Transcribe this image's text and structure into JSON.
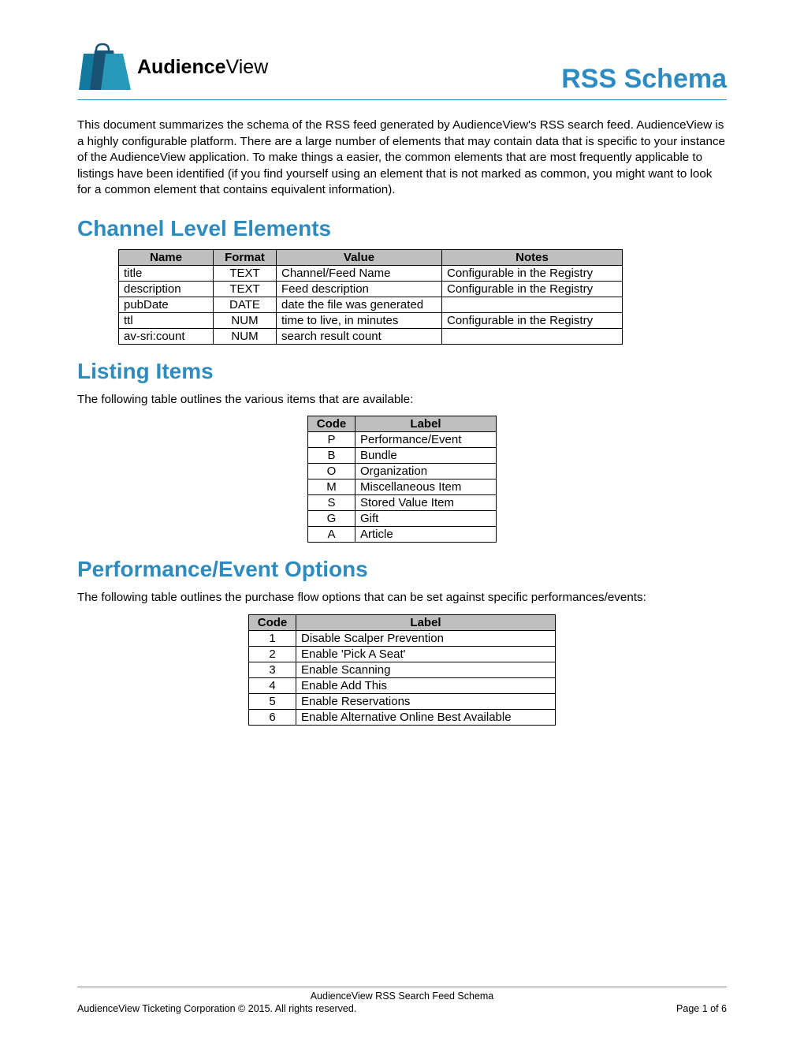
{
  "header": {
    "logo_bold": "Audience",
    "logo_light": "View",
    "doc_title": "RSS Schema"
  },
  "intro": "This document summarizes the schema of the RSS feed generated by AudienceView's RSS search feed. AudienceView is a highly configurable platform. There are a large number of elements that may contain data that is  specific to your instance of the AudienceView application. To make things a easier, the common elements that are most frequently applicable to listings have been identified (if you find yourself using an element that is not marked as common, you might want to look for a common element that contains equivalent information).",
  "sections": {
    "channel": {
      "title": "Channel Level Elements",
      "headers": [
        "Name",
        "Format",
        "Value",
        "Notes"
      ],
      "rows": [
        [
          "title",
          "TEXT",
          "Channel/Feed Name",
          "Configurable in the Registry"
        ],
        [
          "description",
          "TEXT",
          "Feed description",
          "Configurable in the Registry"
        ],
        [
          "pubDate",
          "DATE",
          "date the file was generated",
          ""
        ],
        [
          "ttl",
          "NUM",
          "time to live, in minutes",
          "Configurable in the Registry"
        ],
        [
          "av-sri:count",
          "NUM",
          "search result count",
          ""
        ]
      ]
    },
    "listing": {
      "title": "Listing Items",
      "subtext": "The following table outlines the various items that are available:",
      "headers": [
        "Code",
        "Label"
      ],
      "rows": [
        [
          "P",
          "Performance/Event"
        ],
        [
          "B",
          "Bundle"
        ],
        [
          "O",
          "Organization"
        ],
        [
          "M",
          "Miscellaneous Item"
        ],
        [
          "S",
          "Stored Value Item"
        ],
        [
          "G",
          "Gift"
        ],
        [
          "A",
          "Article"
        ]
      ]
    },
    "perf": {
      "title": "Performance/Event Options",
      "subtext": "The following table outlines the purchase flow options that can be set against specific performances/events:",
      "headers": [
        "Code",
        "Label"
      ],
      "rows": [
        [
          "1",
          "Disable Scalper Prevention"
        ],
        [
          "2",
          "Enable 'Pick A Seat'"
        ],
        [
          "3",
          "Enable Scanning"
        ],
        [
          "4",
          "Enable Add This"
        ],
        [
          "5",
          "Enable Reservations"
        ],
        [
          "6",
          "Enable Alternative Online Best Available"
        ]
      ]
    }
  },
  "footer": {
    "line1": "AudienceView RSS Search Feed Schema",
    "copyright": "AudienceView Ticketing Corporation © 2015. All rights reserved.",
    "page": "Page 1 of 6"
  }
}
